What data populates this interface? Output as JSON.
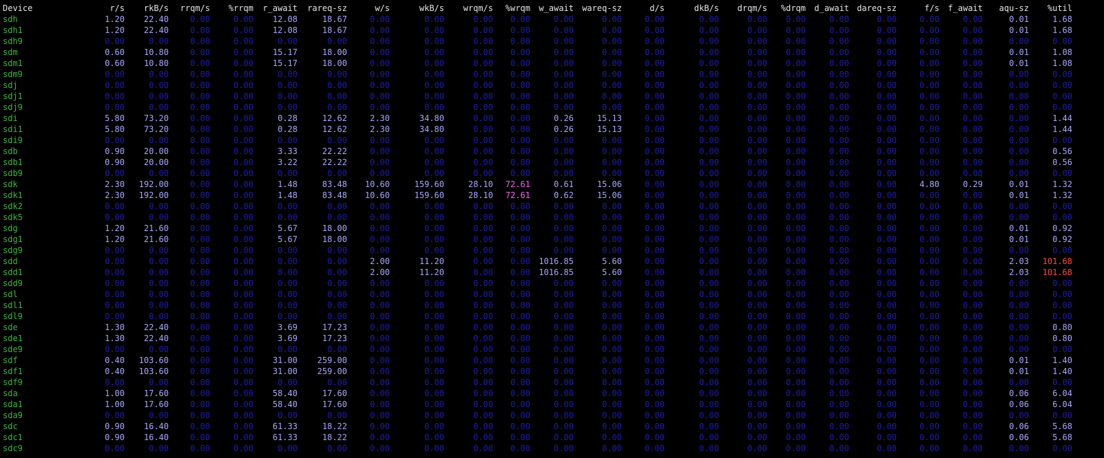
{
  "colors": {
    "background": "#000000",
    "header_text": "#e6e6e6",
    "device_name": "#3bb83b",
    "zero_value": "#1f1fa8",
    "active_value": "#a8a8ff",
    "high_wrqm": "#ff5cff",
    "high_util": "#ff4a3a"
  },
  "headers": [
    "Device",
    "r/s",
    "rkB/s",
    "rrqm/s",
    "%rrqm",
    "r_await",
    "rareq-sz",
    "w/s",
    "wkB/s",
    "wrqm/s",
    "%wrqm",
    "w_await",
    "wareq-sz",
    "d/s",
    "dkB/s",
    "drqm/s",
    "%drqm",
    "d_await",
    "dareq-sz",
    "f/s",
    "f_await",
    "aqu-sz",
    "%util"
  ],
  "rows": [
    [
      "sdh",
      "1.20",
      "22.40",
      "0.00",
      "0.00",
      "12.08",
      "18.67",
      "0.00",
      "0.00",
      "0.00",
      "0.00",
      "0.00",
      "0.00",
      "0.00",
      "0.00",
      "0.00",
      "0.00",
      "0.00",
      "0.00",
      "0.00",
      "0.00",
      "0.01",
      "1.68"
    ],
    [
      "sdh1",
      "1.20",
      "22.40",
      "0.00",
      "0.00",
      "12.08",
      "18.67",
      "0.00",
      "0.00",
      "0.00",
      "0.00",
      "0.00",
      "0.00",
      "0.00",
      "0.00",
      "0.00",
      "0.00",
      "0.00",
      "0.00",
      "0.00",
      "0.00",
      "0.01",
      "1.68"
    ],
    [
      "sdh9",
      "0.00",
      "0.00",
      "0.00",
      "0.00",
      "0.00",
      "0.00",
      "0.00",
      "0.00",
      "0.00",
      "0.00",
      "0.00",
      "0.00",
      "0.00",
      "0.00",
      "0.00",
      "0.00",
      "0.00",
      "0.00",
      "0.00",
      "0.00",
      "0.00",
      "0.00"
    ],
    [
      "sdm",
      "0.60",
      "10.80",
      "0.00",
      "0.00",
      "15.17",
      "18.00",
      "0.00",
      "0.00",
      "0.00",
      "0.00",
      "0.00",
      "0.00",
      "0.00",
      "0.00",
      "0.00",
      "0.00",
      "0.00",
      "0.00",
      "0.00",
      "0.00",
      "0.01",
      "1.08"
    ],
    [
      "sdm1",
      "0.60",
      "10.80",
      "0.00",
      "0.00",
      "15.17",
      "18.00",
      "0.00",
      "0.00",
      "0.00",
      "0.00",
      "0.00",
      "0.00",
      "0.00",
      "0.00",
      "0.00",
      "0.00",
      "0.00",
      "0.00",
      "0.00",
      "0.00",
      "0.01",
      "1.08"
    ],
    [
      "sdm9",
      "0.00",
      "0.00",
      "0.00",
      "0.00",
      "0.00",
      "0.00",
      "0.00",
      "0.00",
      "0.00",
      "0.00",
      "0.00",
      "0.00",
      "0.00",
      "0.00",
      "0.00",
      "0.00",
      "0.00",
      "0.00",
      "0.00",
      "0.00",
      "0.00",
      "0.00"
    ],
    [
      "sdj",
      "0.00",
      "0.00",
      "0.00",
      "0.00",
      "0.00",
      "0.00",
      "0.00",
      "0.00",
      "0.00",
      "0.00",
      "0.00",
      "0.00",
      "0.00",
      "0.00",
      "0.00",
      "0.00",
      "0.00",
      "0.00",
      "0.00",
      "0.00",
      "0.00",
      "0.00"
    ],
    [
      "sdj1",
      "0.00",
      "0.00",
      "0.00",
      "0.00",
      "0.00",
      "0.00",
      "0.00",
      "0.00",
      "0.00",
      "0.00",
      "0.00",
      "0.00",
      "0.00",
      "0.00",
      "0.00",
      "0.00",
      "0.00",
      "0.00",
      "0.00",
      "0.00",
      "0.00",
      "0.00"
    ],
    [
      "sdj9",
      "0.00",
      "0.00",
      "0.00",
      "0.00",
      "0.00",
      "0.00",
      "0.00",
      "0.00",
      "0.00",
      "0.00",
      "0.00",
      "0.00",
      "0.00",
      "0.00",
      "0.00",
      "0.00",
      "0.00",
      "0.00",
      "0.00",
      "0.00",
      "0.00",
      "0.00"
    ],
    [
      "sdi",
      "5.80",
      "73.20",
      "0.00",
      "0.00",
      "0.28",
      "12.62",
      "2.30",
      "34.80",
      "0.00",
      "0.00",
      "0.26",
      "15.13",
      "0.00",
      "0.00",
      "0.00",
      "0.00",
      "0.00",
      "0.00",
      "0.00",
      "0.00",
      "0.00",
      "1.44"
    ],
    [
      "sdi1",
      "5.80",
      "73.20",
      "0.00",
      "0.00",
      "0.28",
      "12.62",
      "2.30",
      "34.80",
      "0.00",
      "0.00",
      "0.26",
      "15.13",
      "0.00",
      "0.00",
      "0.00",
      "0.00",
      "0.00",
      "0.00",
      "0.00",
      "0.00",
      "0.00",
      "1.44"
    ],
    [
      "sdi9",
      "0.00",
      "0.00",
      "0.00",
      "0.00",
      "0.00",
      "0.00",
      "0.00",
      "0.00",
      "0.00",
      "0.00",
      "0.00",
      "0.00",
      "0.00",
      "0.00",
      "0.00",
      "0.00",
      "0.00",
      "0.00",
      "0.00",
      "0.00",
      "0.00",
      "0.00"
    ],
    [
      "sdb",
      "0.90",
      "20.00",
      "0.00",
      "0.00",
      "3.33",
      "22.22",
      "0.00",
      "0.00",
      "0.00",
      "0.00",
      "0.00",
      "0.00",
      "0.00",
      "0.00",
      "0.00",
      "0.00",
      "0.00",
      "0.00",
      "0.00",
      "0.00",
      "0.00",
      "0.56"
    ],
    [
      "sdb1",
      "0.90",
      "20.00",
      "0.00",
      "0.00",
      "3.22",
      "22.22",
      "0.00",
      "0.00",
      "0.00",
      "0.00",
      "0.00",
      "0.00",
      "0.00",
      "0.00",
      "0.00",
      "0.00",
      "0.00",
      "0.00",
      "0.00",
      "0.00",
      "0.00",
      "0.56"
    ],
    [
      "sdb9",
      "0.00",
      "0.00",
      "0.00",
      "0.00",
      "0.00",
      "0.00",
      "0.00",
      "0.00",
      "0.00",
      "0.00",
      "0.00",
      "0.00",
      "0.00",
      "0.00",
      "0.00",
      "0.00",
      "0.00",
      "0.00",
      "0.00",
      "0.00",
      "0.00",
      "0.00"
    ],
    [
      "sdk",
      "2.30",
      "192.00",
      "0.00",
      "0.00",
      "1.48",
      "83.48",
      "10.60",
      "159.60",
      "28.10",
      "72.61",
      "0.61",
      "15.06",
      "0.00",
      "0.00",
      "0.00",
      "0.00",
      "0.00",
      "0.00",
      "4.80",
      "0.29",
      "0.01",
      "1.32"
    ],
    [
      "sdk1",
      "2.30",
      "192.00",
      "0.00",
      "0.00",
      "1.48",
      "83.48",
      "10.60",
      "159.60",
      "28.10",
      "72.61",
      "0.62",
      "15.06",
      "0.00",
      "0.00",
      "0.00",
      "0.00",
      "0.00",
      "0.00",
      "0.00",
      "0.00",
      "0.01",
      "1.32"
    ],
    [
      "sdk2",
      "0.00",
      "0.00",
      "0.00",
      "0.00",
      "0.00",
      "0.00",
      "0.00",
      "0.00",
      "0.00",
      "0.00",
      "0.00",
      "0.00",
      "0.00",
      "0.00",
      "0.00",
      "0.00",
      "0.00",
      "0.00",
      "0.00",
      "0.00",
      "0.00",
      "0.00"
    ],
    [
      "sdk5",
      "0.00",
      "0.00",
      "0.00",
      "0.00",
      "0.00",
      "0.00",
      "0.00",
      "0.00",
      "0.00",
      "0.00",
      "0.00",
      "0.00",
      "0.00",
      "0.00",
      "0.00",
      "0.00",
      "0.00",
      "0.00",
      "0.00",
      "0.00",
      "0.00",
      "0.00"
    ],
    [
      "sdg",
      "1.20",
      "21.60",
      "0.00",
      "0.00",
      "5.67",
      "18.00",
      "0.00",
      "0.00",
      "0.00",
      "0.00",
      "0.00",
      "0.00",
      "0.00",
      "0.00",
      "0.00",
      "0.00",
      "0.00",
      "0.00",
      "0.00",
      "0.00",
      "0.01",
      "0.92"
    ],
    [
      "sdg1",
      "1.20",
      "21.60",
      "0.00",
      "0.00",
      "5.67",
      "18.00",
      "0.00",
      "0.00",
      "0.00",
      "0.00",
      "0.00",
      "0.00",
      "0.00",
      "0.00",
      "0.00",
      "0.00",
      "0.00",
      "0.00",
      "0.00",
      "0.00",
      "0.01",
      "0.92"
    ],
    [
      "sdg9",
      "0.00",
      "0.00",
      "0.00",
      "0.00",
      "0.00",
      "0.00",
      "0.00",
      "0.00",
      "0.00",
      "0.00",
      "0.00",
      "0.00",
      "0.00",
      "0.00",
      "0.00",
      "0.00",
      "0.00",
      "0.00",
      "0.00",
      "0.00",
      "0.00",
      "0.00"
    ],
    [
      "sdd",
      "0.00",
      "0.00",
      "0.00",
      "0.00",
      "0.00",
      "0.00",
      "2.00",
      "11.20",
      "0.00",
      "0.00",
      "1016.85",
      "5.60",
      "0.00",
      "0.00",
      "0.00",
      "0.00",
      "0.00",
      "0.00",
      "0.00",
      "0.00",
      "2.03",
      "101.68"
    ],
    [
      "sdd1",
      "0.00",
      "0.00",
      "0.00",
      "0.00",
      "0.00",
      "0.00",
      "2.00",
      "11.20",
      "0.00",
      "0.00",
      "1016.85",
      "5.60",
      "0.00",
      "0.00",
      "0.00",
      "0.00",
      "0.00",
      "0.00",
      "0.00",
      "0.00",
      "2.03",
      "101.68"
    ],
    [
      "sdd9",
      "0.00",
      "0.00",
      "0.00",
      "0.00",
      "0.00",
      "0.00",
      "0.00",
      "0.00",
      "0.00",
      "0.00",
      "0.00",
      "0.00",
      "0.00",
      "0.00",
      "0.00",
      "0.00",
      "0.00",
      "0.00",
      "0.00",
      "0.00",
      "0.00",
      "0.00"
    ],
    [
      "sdl",
      "0.00",
      "0.00",
      "0.00",
      "0.00",
      "0.00",
      "0.00",
      "0.00",
      "0.00",
      "0.00",
      "0.00",
      "0.00",
      "0.00",
      "0.00",
      "0.00",
      "0.00",
      "0.00",
      "0.00",
      "0.00",
      "0.00",
      "0.00",
      "0.00",
      "0.00"
    ],
    [
      "sdl1",
      "0.00",
      "0.00",
      "0.00",
      "0.00",
      "0.00",
      "0.00",
      "0.00",
      "0.00",
      "0.00",
      "0.00",
      "0.00",
      "0.00",
      "0.00",
      "0.00",
      "0.00",
      "0.00",
      "0.00",
      "0.00",
      "0.00",
      "0.00",
      "0.00",
      "0.00"
    ],
    [
      "sdl9",
      "0.00",
      "0.00",
      "0.00",
      "0.00",
      "0.00",
      "0.00",
      "0.00",
      "0.00",
      "0.00",
      "0.00",
      "0.00",
      "0.00",
      "0.00",
      "0.00",
      "0.00",
      "0.00",
      "0.00",
      "0.00",
      "0.00",
      "0.00",
      "0.00",
      "0.00"
    ],
    [
      "sde",
      "1.30",
      "22.40",
      "0.00",
      "0.00",
      "3.69",
      "17.23",
      "0.00",
      "0.00",
      "0.00",
      "0.00",
      "0.00",
      "0.00",
      "0.00",
      "0.00",
      "0.00",
      "0.00",
      "0.00",
      "0.00",
      "0.00",
      "0.00",
      "0.00",
      "0.80"
    ],
    [
      "sde1",
      "1.30",
      "22.40",
      "0.00",
      "0.00",
      "3.69",
      "17.23",
      "0.00",
      "0.00",
      "0.00",
      "0.00",
      "0.00",
      "0.00",
      "0.00",
      "0.00",
      "0.00",
      "0.00",
      "0.00",
      "0.00",
      "0.00",
      "0.00",
      "0.00",
      "0.80"
    ],
    [
      "sde9",
      "0.00",
      "0.00",
      "0.00",
      "0.00",
      "0.00",
      "0.00",
      "0.00",
      "0.00",
      "0.00",
      "0.00",
      "0.00",
      "0.00",
      "0.00",
      "0.00",
      "0.00",
      "0.00",
      "0.00",
      "0.00",
      "0.00",
      "0.00",
      "0.00",
      "0.00"
    ],
    [
      "sdf",
      "0.40",
      "103.60",
      "0.00",
      "0.00",
      "31.00",
      "259.00",
      "0.00",
      "0.00",
      "0.00",
      "0.00",
      "0.00",
      "0.00",
      "0.00",
      "0.00",
      "0.00",
      "0.00",
      "0.00",
      "0.00",
      "0.00",
      "0.00",
      "0.01",
      "1.40"
    ],
    [
      "sdf1",
      "0.40",
      "103.60",
      "0.00",
      "0.00",
      "31.00",
      "259.00",
      "0.00",
      "0.00",
      "0.00",
      "0.00",
      "0.00",
      "0.00",
      "0.00",
      "0.00",
      "0.00",
      "0.00",
      "0.00",
      "0.00",
      "0.00",
      "0.00",
      "0.01",
      "1.40"
    ],
    [
      "sdf9",
      "0.00",
      "0.00",
      "0.00",
      "0.00",
      "0.00",
      "0.00",
      "0.00",
      "0.00",
      "0.00",
      "0.00",
      "0.00",
      "0.00",
      "0.00",
      "0.00",
      "0.00",
      "0.00",
      "0.00",
      "0.00",
      "0.00",
      "0.00",
      "0.00",
      "0.00"
    ],
    [
      "sda",
      "1.00",
      "17.60",
      "0.00",
      "0.00",
      "58.40",
      "17.60",
      "0.00",
      "0.00",
      "0.00",
      "0.00",
      "0.00",
      "0.00",
      "0.00",
      "0.00",
      "0.00",
      "0.00",
      "0.00",
      "0.00",
      "0.00",
      "0.00",
      "0.06",
      "6.04"
    ],
    [
      "sda1",
      "1.00",
      "17.60",
      "0.00",
      "0.00",
      "58.40",
      "17.60",
      "0.00",
      "0.00",
      "0.00",
      "0.00",
      "0.00",
      "0.00",
      "0.00",
      "0.00",
      "0.00",
      "0.00",
      "0.00",
      "0.00",
      "0.00",
      "0.00",
      "0.06",
      "6.04"
    ],
    [
      "sda9",
      "0.00",
      "0.00",
      "0.00",
      "0.00",
      "0.00",
      "0.00",
      "0.00",
      "0.00",
      "0.00",
      "0.00",
      "0.00",
      "0.00",
      "0.00",
      "0.00",
      "0.00",
      "0.00",
      "0.00",
      "0.00",
      "0.00",
      "0.00",
      "0.00",
      "0.00"
    ],
    [
      "sdc",
      "0.90",
      "16.40",
      "0.00",
      "0.00",
      "61.33",
      "18.22",
      "0.00",
      "0.00",
      "0.00",
      "0.00",
      "0.00",
      "0.00",
      "0.00",
      "0.00",
      "0.00",
      "0.00",
      "0.00",
      "0.00",
      "0.00",
      "0.00",
      "0.06",
      "5.68"
    ],
    [
      "sdc1",
      "0.90",
      "16.40",
      "0.00",
      "0.00",
      "61.33",
      "18.22",
      "0.00",
      "0.00",
      "0.00",
      "0.00",
      "0.00",
      "0.00",
      "0.00",
      "0.00",
      "0.00",
      "0.00",
      "0.00",
      "0.00",
      "0.00",
      "0.00",
      "0.06",
      "5.68"
    ],
    [
      "sdc9",
      "0.00",
      "0.00",
      "0.00",
      "0.00",
      "0.00",
      "0.00",
      "0.00",
      "0.00",
      "0.00",
      "0.00",
      "0.00",
      "0.00",
      "0.00",
      "0.00",
      "0.00",
      "0.00",
      "0.00",
      "0.00",
      "0.00",
      "0.00",
      "0.00",
      "0.00"
    ]
  ]
}
